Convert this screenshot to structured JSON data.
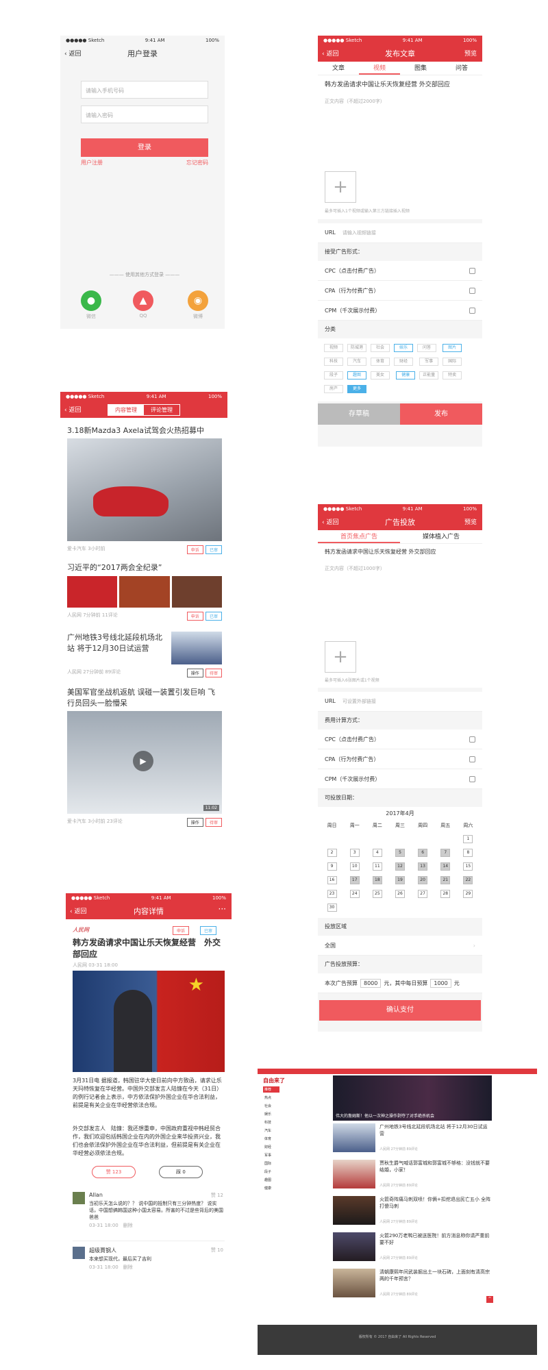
{
  "status": {
    "carrier": "●●●●● Sketch",
    "time": "9:41 AM",
    "battery": "100%"
  },
  "login": {
    "back": "返回",
    "title": "用户登录",
    "phone_placeholder": "请输入手机号码",
    "password_placeholder": "请输入密码",
    "login_button": "登录",
    "register": "用户注册",
    "forgot": "忘记密码",
    "other_login": "使用其他方式登录",
    "wechat": "微信",
    "qq": "QQ",
    "weibo": "微博"
  },
  "publish": {
    "back": "返回",
    "title": "发布文章",
    "preview": "预览",
    "tabs": [
      "文章",
      "视频",
      "图集",
      "问答"
    ],
    "headline": "韩方发函请求中国让乐天恢复经营 外交部回应",
    "body_placeholder": "正文内容（不超过2000字）",
    "upload_hint": "最多可插入1个视频或输入第三方链接插入视频",
    "url_label": "URL",
    "url_placeholder": "请输入视频链接",
    "ad_form_label": "接受广告形式：",
    "ad_options": [
      "CPC（点击付费广告）",
      "CPA（行为付费广告）",
      "CPM（千次展示付费）"
    ],
    "category_label": "分类",
    "categories": [
      "视频",
      "防城港",
      "社会",
      "娱乐",
      "问答",
      "图片",
      "科技",
      "汽车",
      "体育",
      "财经",
      "军事",
      "国际",
      "段子",
      "趣图",
      "美女",
      "健康",
      "正能量",
      "特卖",
      "房产",
      "更多"
    ],
    "save_draft": "存草稿",
    "publish": "发布"
  },
  "content_mgmt": {
    "back": "返回",
    "tab_content": "内容管理",
    "tab_comment": "评论管理",
    "items": [
      {
        "title": "3.18新Mazda3 Axela试驾会火热招募中",
        "meta": "爱卡汽车 3小时前",
        "a": "申诉",
        "b": "已审"
      },
      {
        "title": "习近平的“2017两会全纪录”",
        "meta": "人民网 7分钟前 11评论",
        "a": "申诉",
        "b": "已审"
      },
      {
        "title": "广州地铁3号线北延段机场北站 将于12月30日试运营",
        "meta": "人民网 27分钟前 89评论",
        "a": "操作",
        "b": "待审"
      },
      {
        "title": "美国军官坐战机返航 误碰一装置引发巨响 飞行员回头一脸懵呆",
        "meta": "爱卡汽车 3小时前 23评论",
        "a": "操作",
        "b": "待审",
        "duration": "11:02"
      }
    ]
  },
  "detail": {
    "back": "返回",
    "title": "内容详情",
    "more": "···",
    "source_logo": "人民网",
    "appeal": "申诉",
    "reviewed": "已审",
    "headline": "韩方发函请求中国让乐天恢复经营　外交部回应",
    "meta": "人民网 03-31 18:00",
    "para1": "3月31日电 据报道，韩国驻华大使日前向中方致函，请求让乐天玛特恢复在华经营。中国外交部发言人陆慷在今天（31日）的例行记者会上表示，中方依法保护外国企业在华合法利益，前提是有关企业在华经营依法合规。",
    "para2": "外交部发言人　陆慷：我还想重申，中国政府重视中韩经贸合作，我们欢迎包括韩国企业在内的外国企业来华投资兴业，我们也会依法保护外国企业在华合法利益，但前提是有关企业在华经营必须依法合规。",
    "like": "赞 123",
    "dislike": "踩 0",
    "comments": [
      {
        "user": "Allan",
        "likes": "赞 12",
        "text": "当初乐天怎么说的？？ 说中国的抵制只有三分钟热度？ 说实话，中国想搞韩国这种小国太容易。所害的不过是些背后的美国爸爸",
        "time": "03-31 18:00",
        "del": "删除"
      },
      {
        "user": "超级賈钢人",
        "likes": "赞 10",
        "text": "本来想买现代，最后买了吉利",
        "time": "03-31 18:00",
        "del": "删除"
      }
    ]
  },
  "ad": {
    "back": "返回",
    "title": "广告投放",
    "preview": "预览",
    "tabs": [
      "首页焦点广告",
      "媒体植入广告"
    ],
    "headline": "韩方发函请求中国让乐天恢复经营 外交部回应",
    "body_placeholder": "正文内容（不超过1000字）",
    "upload_hint": "最多可插入6张图片或1个视频",
    "url_label": "URL",
    "url_placeholder": "可设置外部链接",
    "fee_label": "费用计算方式：",
    "fee_options": [
      "CPC（点击付费广告）",
      "CPA（行为付费广告）",
      "CPM（千次展示付费）"
    ],
    "date_label": "可投放日期：",
    "month": "2017年4月",
    "weekdays": [
      "周日",
      "周一",
      "周二",
      "周三",
      "周四",
      "周五",
      "周六"
    ],
    "region_label": "投放区域",
    "region_value": "全国",
    "budget_label": "广告投放预算：",
    "budget_prefix": "本次广告预算",
    "budget_total": "8000",
    "budget_mid": "元，其中每日预算",
    "budget_daily": "1000",
    "budget_unit": "元",
    "pay": "确认支付"
  },
  "desktop": {
    "logo": "自由来了",
    "hero_caption": "伟大的詹姆斯！他以一次神之操作剥夺了对手绝杀机会",
    "nav_items": [
      "推荐",
      "热点",
      "社会",
      "娱乐",
      "科技",
      "汽车",
      "体育",
      "财经",
      "军事",
      "国际",
      "段子",
      "趣图",
      "健康"
    ],
    "rows": [
      {
        "title": "广州地铁3号线北延段机场北站 将于12月30日试运营",
        "meta": "人民网 27分钟前 89评论"
      },
      {
        "title": "贾秋生爵气喊话郭富城和郭富城不够格：没钱就不要结婚，小家！",
        "meta": "人民网 27分钟前 89评论"
      },
      {
        "title": "火箭奇阵痛马刺双喷！你俩+扣挖退出民亡五小 全阵打傻马刺",
        "meta": "人民网 27分钟前 89评论"
      },
      {
        "title": "火箭290万老鸭已被送医院！前方消息称你请严重前要不好",
        "meta": "人民网 27分钟前 89评论"
      },
      {
        "title": "清朝康熙年间武装掘出土一块石碑，上面刻有清高宗两的千年预言？",
        "meta": "人民网 27分钟前 89评论"
      }
    ],
    "footer": "版权所有 © 2017 自由来了 All Rights Reserved"
  }
}
